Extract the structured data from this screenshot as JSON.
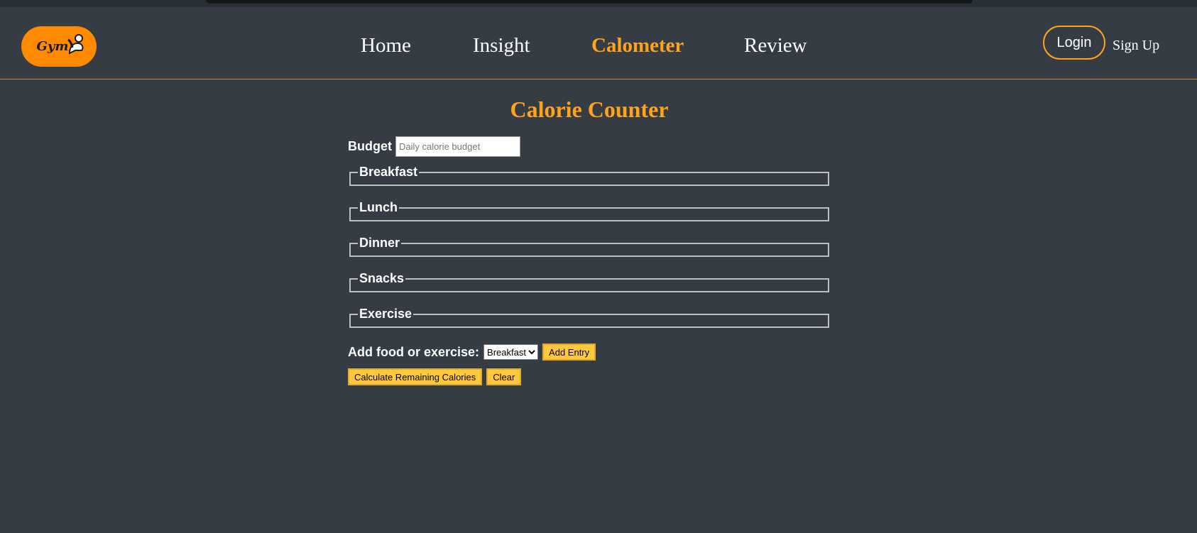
{
  "brand": {
    "logo_text": "Gym"
  },
  "nav": {
    "home": "Home",
    "insight": "Insight",
    "calometer": "Calometer",
    "review": "Review"
  },
  "auth": {
    "login": "Login",
    "signup": "Sign Up"
  },
  "colors": {
    "accent": "#ffa31a",
    "background": "#353c43",
    "logo_bg": "#ff8a00",
    "button": "#ffc83d"
  },
  "page": {
    "title": "Calorie Counter",
    "budget_label": "Budget",
    "budget_placeholder": "Daily calorie budget",
    "sections": [
      "Breakfast",
      "Lunch",
      "Dinner",
      "Snacks",
      "Exercise"
    ],
    "add_label": "Add food or exercise:",
    "select_value": "Breakfast",
    "add_entry": "Add Entry",
    "calculate": "Calculate Remaining Calories",
    "clear": "Clear"
  }
}
